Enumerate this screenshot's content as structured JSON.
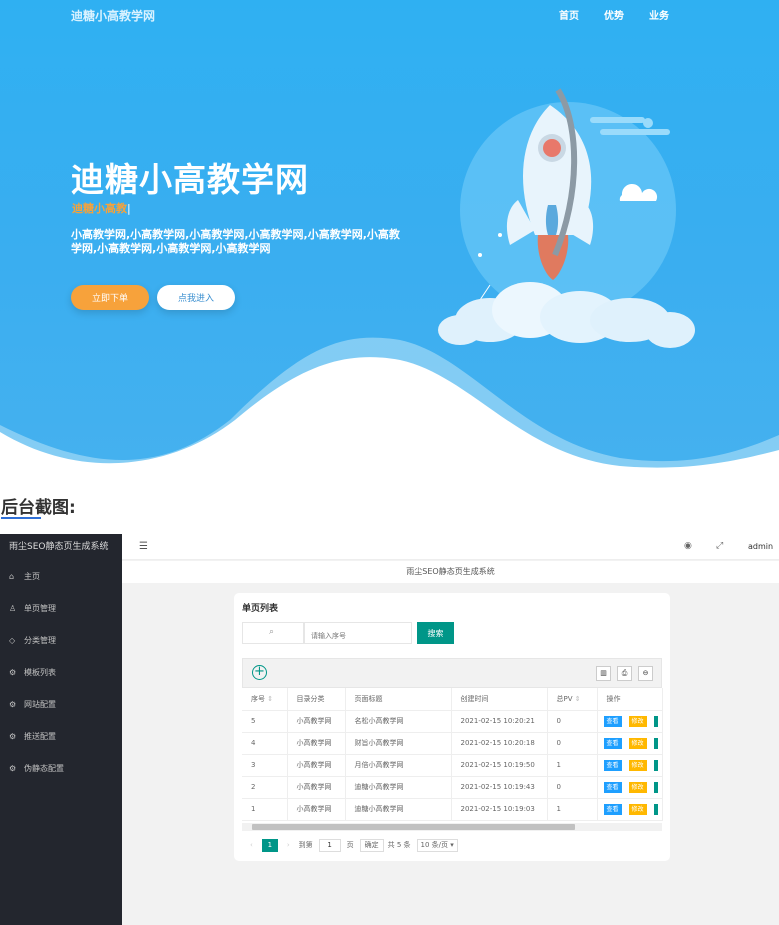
{
  "hero": {
    "brand": "迪糖小高教学网",
    "nav": [
      "首页",
      "优势",
      "业务"
    ],
    "title": "迪糖小高教学网",
    "subtitle": "迪糖小高教",
    "caret": "|",
    "description": "小高教学网,小高教学网,小高教学网,小高教学网,小高教学网,小高教学网,小高教学网,小高教学网,小高教学网",
    "btn_order": "立即下单",
    "btn_enter": "点我进入",
    "colors": {
      "sky": "#3aaef0",
      "accent": "#f7a23b"
    }
  },
  "section": {
    "title": "后台截图:"
  },
  "admin": {
    "system_title": "雨尘SEO静态页生成系统",
    "menu": [
      {
        "icon": "home-icon",
        "glyph": "⌂",
        "label": "主页"
      },
      {
        "icon": "user-icon",
        "glyph": "♙",
        "label": "单页管理"
      },
      {
        "icon": "tag-icon",
        "glyph": "◇",
        "label": "分类管理"
      },
      {
        "icon": "gear-icon",
        "glyph": "⚙",
        "label": "模板列表"
      },
      {
        "icon": "gear-icon",
        "glyph": "⚙",
        "label": "网站配置"
      },
      {
        "icon": "gear-icon",
        "glyph": "⚙",
        "label": "推送配置"
      },
      {
        "icon": "gear-icon",
        "glyph": "⚙",
        "label": "伪静态配置"
      }
    ],
    "user": "admin",
    "tab_label": "雨尘SEO静态页生成系统",
    "card_title": "单页列表",
    "search_placeholder": "请输入序号",
    "search_button": "搜索",
    "table": {
      "headers": [
        "序号",
        "目录分类",
        "页面标题",
        "创建时间",
        "总PV",
        "操作"
      ],
      "rows": [
        {
          "id": "5",
          "category": "小高教学网",
          "title": "名松小高教学网",
          "created": "2021-02-15 10:20:21",
          "pv": "0"
        },
        {
          "id": "4",
          "category": "小高教学网",
          "title": "财旨小高教学网",
          "created": "2021-02-15 10:20:18",
          "pv": "0"
        },
        {
          "id": "3",
          "category": "小高教学网",
          "title": "月倍小高教学网",
          "created": "2021-02-15 10:19:50",
          "pv": "1"
        },
        {
          "id": "2",
          "category": "小高教学网",
          "title": "迪糖小高教学网",
          "created": "2021-02-15 10:19:43",
          "pv": "0"
        },
        {
          "id": "1",
          "category": "小高教学网",
          "title": "迪糖小高教学网",
          "created": "2021-02-15 10:19:03",
          "pv": "1"
        }
      ],
      "action_view": "查看",
      "action_edit": "修改"
    },
    "pager": {
      "current": "1",
      "goto_prefix": "到第",
      "goto_value": "1",
      "goto_suffix": "页",
      "confirm": "确定",
      "total": "共 5 条",
      "page_size": "10 条/页"
    }
  }
}
